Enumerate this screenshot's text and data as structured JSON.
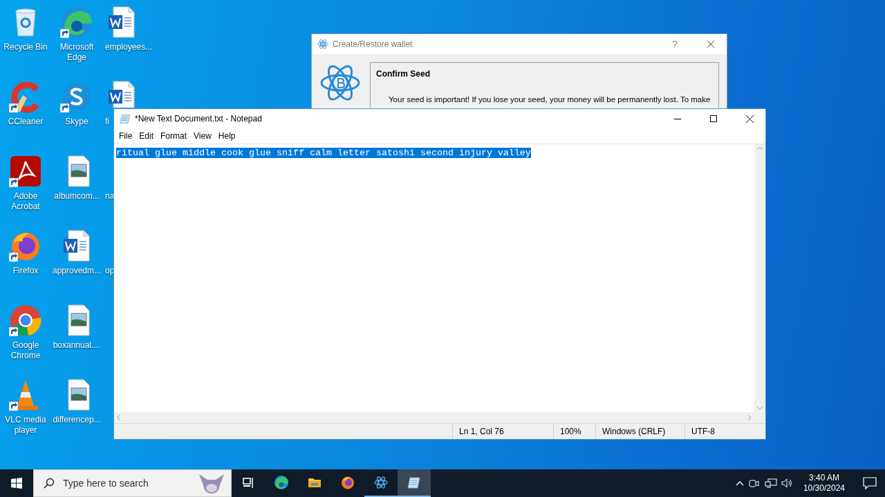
{
  "desktop_icons": [
    {
      "label": "Recycle Bin",
      "kind": "recycle",
      "shortcut": false
    },
    {
      "label": "CCleaner",
      "kind": "ccleaner",
      "shortcut": true
    },
    {
      "label": "Adobe Acrobat",
      "kind": "acrobat",
      "shortcut": true
    },
    {
      "label": "Firefox",
      "kind": "firefox",
      "shortcut": true
    },
    {
      "label": "Google Chrome",
      "kind": "chrome",
      "shortcut": true
    },
    {
      "label": "VLC media player",
      "kind": "vlc",
      "shortcut": true
    },
    {
      "label": "Microsoft Edge",
      "kind": "edge",
      "shortcut": true
    },
    {
      "label": "Skype",
      "kind": "skype",
      "shortcut": true
    },
    {
      "label": "albumcom...",
      "kind": "image",
      "shortcut": false
    },
    {
      "label": "approvedm...",
      "kind": "word",
      "shortcut": false
    },
    {
      "label": "boxannual....",
      "kind": "image",
      "shortcut": false
    },
    {
      "label": "differencep...",
      "kind": "image",
      "shortcut": false
    },
    {
      "label": "employees...",
      "kind": "word",
      "shortcut": false
    },
    {
      "label": "fi",
      "kind": "word",
      "shortcut": false
    },
    {
      "label": "na",
      "kind": "hidden"
    },
    {
      "label": "op",
      "kind": "hidden"
    }
  ],
  "wallet_dialog": {
    "title": "Create/Restore wallet",
    "help": "?",
    "heading": "Confirm Seed",
    "message": "Your seed is important! If you lose your seed, your money will be permanently lost. To make"
  },
  "notepad": {
    "title": "*New Text Document.txt - Notepad",
    "menu": [
      "File",
      "Edit",
      "Format",
      "View",
      "Help"
    ],
    "text": "ritual glue middle cook glue sniff calm letter satoshi second injury valley",
    "selected": true,
    "status": [
      "Ln 1, Col 76",
      "100%",
      "Windows (CRLF)",
      "UTF-8"
    ]
  },
  "taskbar": {
    "search": {
      "placeholder": "Type here to search"
    },
    "apps": [
      {
        "kind": "taskview",
        "open": false,
        "active": false
      },
      {
        "kind": "edge",
        "open": false,
        "active": false
      },
      {
        "kind": "explorer",
        "open": false,
        "active": false
      },
      {
        "kind": "firefox",
        "open": false,
        "active": false
      },
      {
        "kind": "electrum",
        "open": true,
        "active": false
      },
      {
        "kind": "notepad",
        "open": true,
        "active": true
      }
    ],
    "clock": {
      "time": "3:40 AM",
      "date": "10/30/2024"
    }
  }
}
